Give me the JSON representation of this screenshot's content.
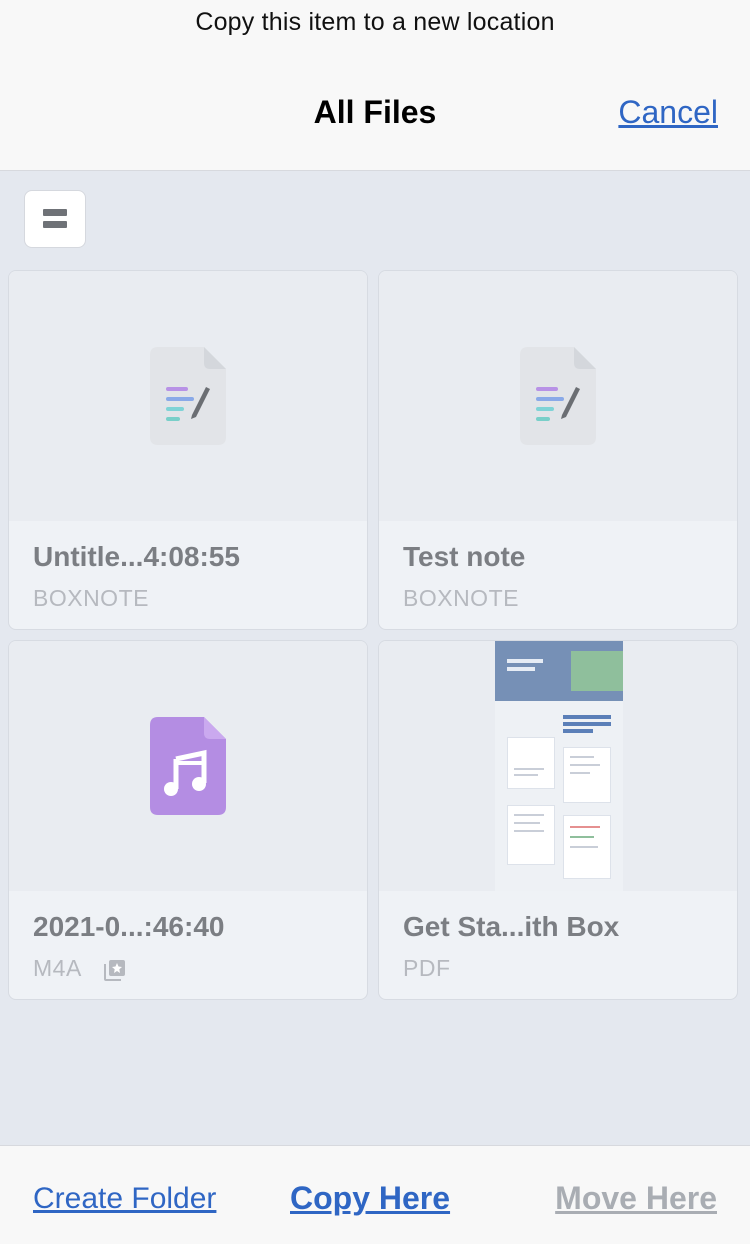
{
  "header": {
    "prompt": "Copy this item to a new location",
    "title": "All Files",
    "cancel_label": "Cancel"
  },
  "toolbar": {
    "view_toggle_icon": "list-view-icon"
  },
  "files": [
    {
      "name": "Untitle...4:08:55",
      "type": "BOXNOTE",
      "icon": "boxnote-icon"
    },
    {
      "name": "Test note",
      "type": "BOXNOTE",
      "icon": "boxnote-icon"
    },
    {
      "name": "2021-0...:46:40",
      "type": "M4A",
      "icon": "audio-file-icon",
      "badge_icon": "shared-collection-icon"
    },
    {
      "name": "Get Sta...ith Box",
      "type": "PDF",
      "icon": "pdf-thumbnail"
    }
  ],
  "pdf_thumb": {
    "top_text": "Simplify how you work",
    "heading": "Everything you need to get work done"
  },
  "bottom_bar": {
    "create_folder_label": "Create Folder",
    "copy_here_label": "Copy Here",
    "move_here_label": "Move Here"
  },
  "colors": {
    "accent": "#2f66c4",
    "disabled": "#a9adb3",
    "audio_purple": "#b48de3",
    "boxnote_gray": "#e2e4e8"
  }
}
